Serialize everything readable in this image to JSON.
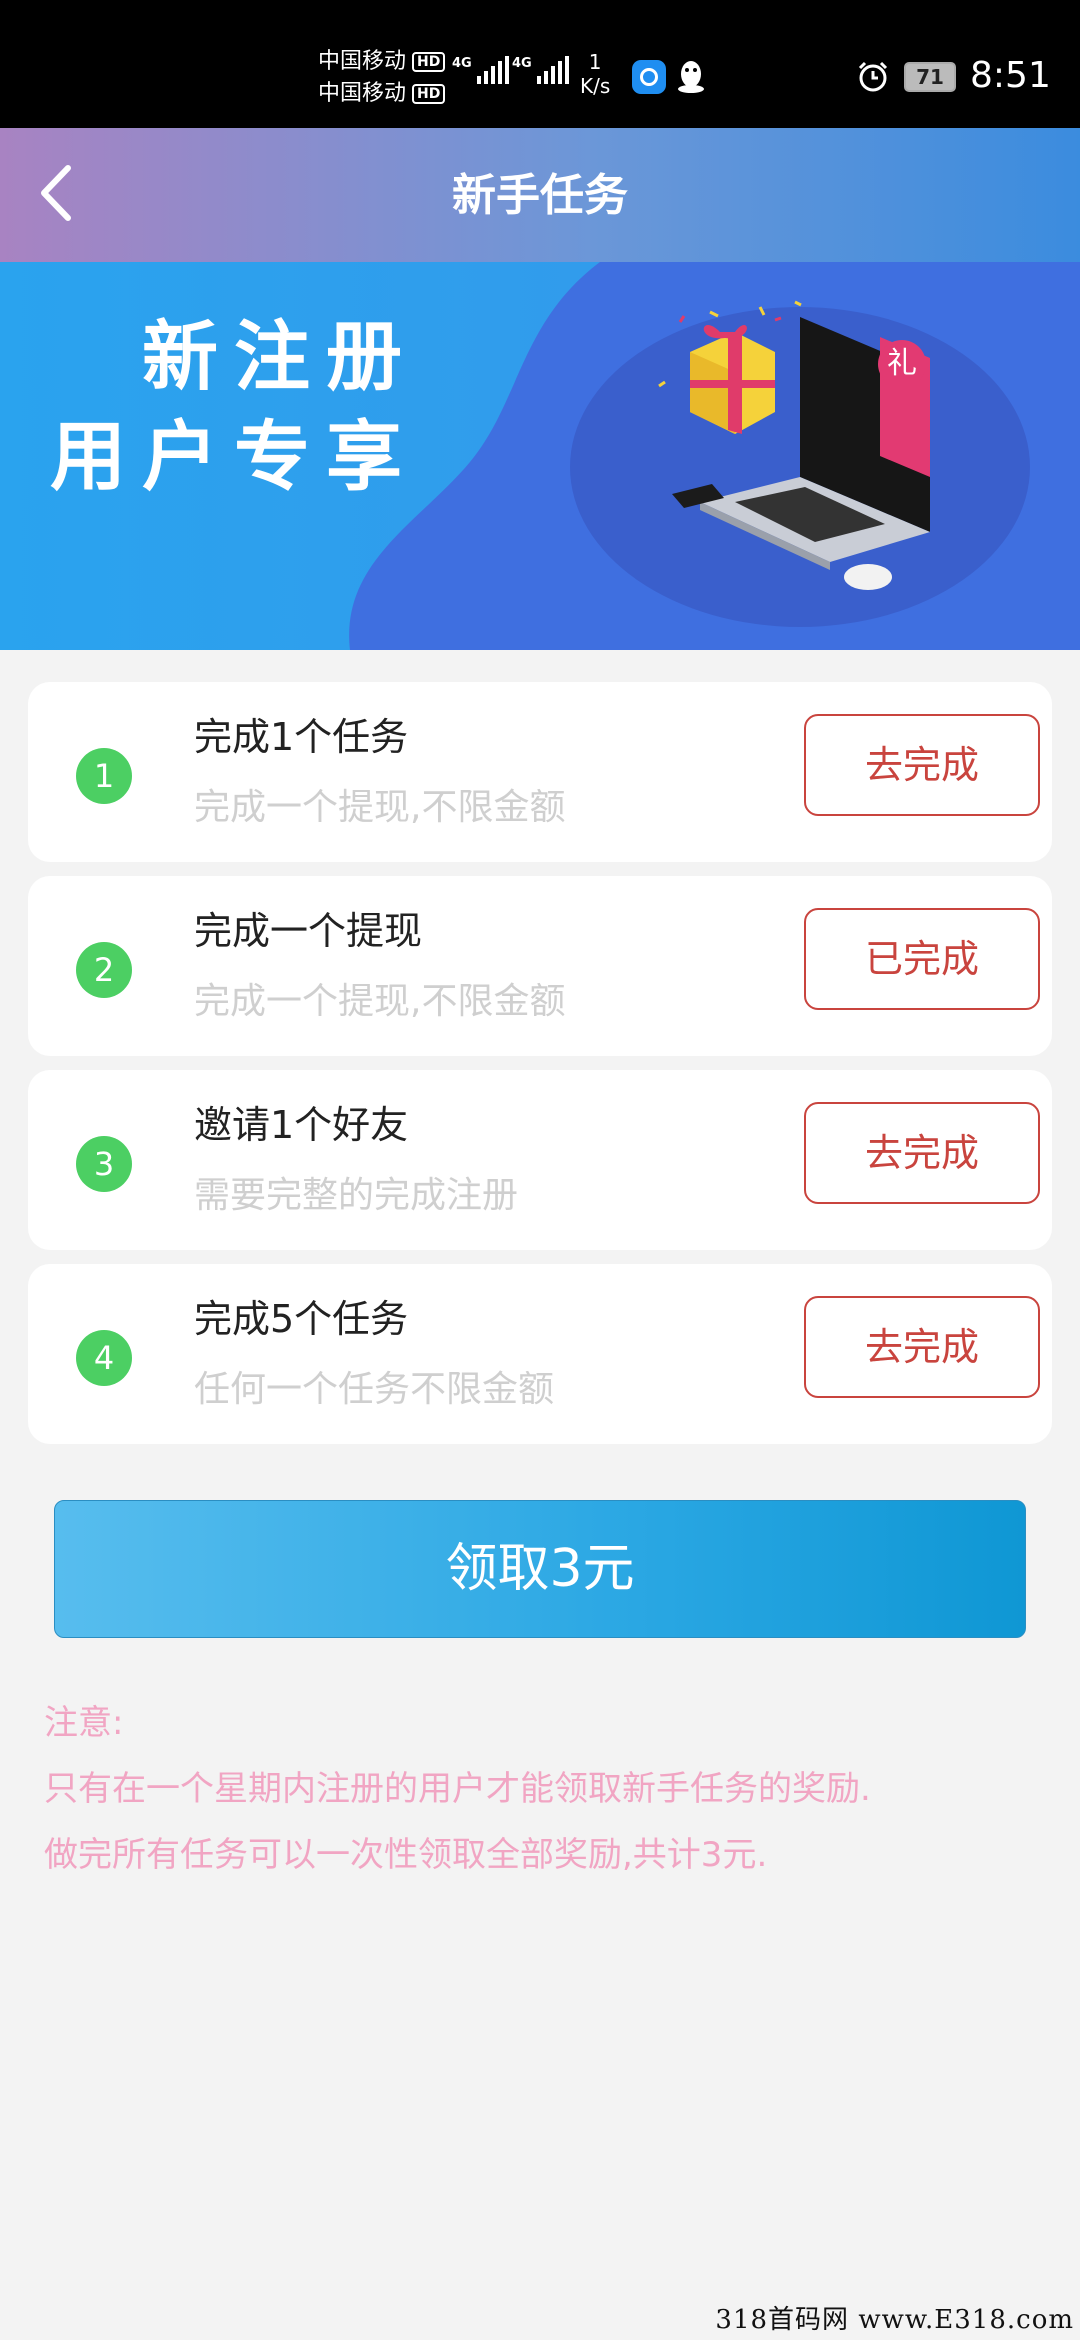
{
  "status_bar": {
    "carrier_1": "中国移动",
    "carrier_2": "中国移动",
    "hd_badge": "HD",
    "network_type": "4G",
    "speed_value": "1",
    "speed_unit": "K/s",
    "battery": "71",
    "time": "8:51",
    "icons": [
      "signal-bars-icon",
      "app-notification-icon",
      "qq-penguin-icon",
      "alarm-clock-icon",
      "battery-icon"
    ]
  },
  "header": {
    "title": "新手任务",
    "back_icon": "chevron-left-icon"
  },
  "banner": {
    "line_1": "新注册",
    "line_2": "用户专享",
    "gift_tag": "礼",
    "colors": {
      "background": "#2f9ded",
      "wave": "#3f6fe0"
    }
  },
  "tasks": [
    {
      "number": "1",
      "title": "完成1个任务",
      "description": "完成一个提现,不限金额",
      "button": "去完成"
    },
    {
      "number": "2",
      "title": "完成一个提现",
      "description": "完成一个提现,不限金额",
      "button": "已完成"
    },
    {
      "number": "3",
      "title": "邀请1个好友",
      "description": "需要完整的完成注册",
      "button": "去完成"
    },
    {
      "number": "4",
      "title": "完成5个任务",
      "description": "任何一个任务不限金额",
      "button": "去完成"
    }
  ],
  "claim_button": "领取3元",
  "notes": {
    "heading": "注意:",
    "line_1": "只有在一个星期内注册的用户才能领取新手任务的奖励.",
    "line_2": "做完所有任务可以一次性领取全部奖励,共计3元."
  },
  "watermark": "318首码网  www.E318.com",
  "colors": {
    "accent_green": "#4ccf63",
    "button_red": "#c9443e",
    "claim_blue": "#2aa7e3",
    "note_pink": "#f1a5c3"
  }
}
